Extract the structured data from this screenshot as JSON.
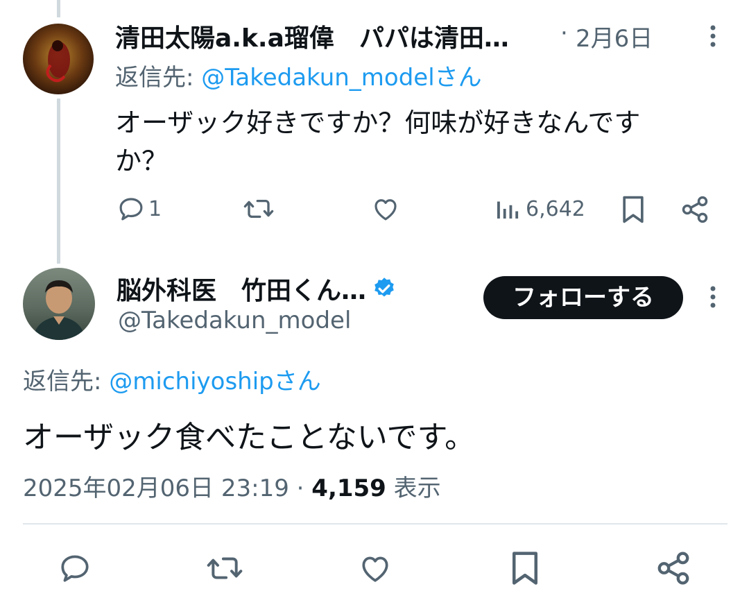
{
  "parent_tweet": {
    "display_name": "清田太陽a.k.a瑠偉　パパは清田…",
    "date": "2月6日",
    "date_sep": "·",
    "reply_prefix": "返信先: ",
    "reply_handle": "@Takedakun_modelさん",
    "text_line1": "オーザック好きですか？何味が好きなんです",
    "text_line2": "か？",
    "reply_count": "1",
    "view_count": "6,642",
    "icons": [
      "more-vertical-icon",
      "reply-icon",
      "retweet-icon",
      "like-icon",
      "views-icon",
      "bookmark-icon",
      "share-icon"
    ]
  },
  "main_tweet": {
    "display_name": "脳外科医　竹田くん…",
    "handle": "@Takedakun_model",
    "follow_label": "フォローする",
    "reply_prefix": "返信先: ",
    "reply_handle": "@michiyoshipさん",
    "text": "オーザック食べたことないです。",
    "timestamp": "2025年02月06日 23:19",
    "meta_sep": " · ",
    "view_count": "4,159",
    "view_label": " 表示",
    "icons": [
      "verified-badge-icon",
      "more-vertical-icon",
      "reply-icon",
      "retweet-icon",
      "like-icon",
      "bookmark-icon",
      "share-icon"
    ]
  },
  "colors": {
    "text": "#0f1419",
    "secondary": "#536471",
    "link": "#1d9bf0",
    "button_bg": "#0f1419",
    "thread_line": "#cfd9de"
  }
}
